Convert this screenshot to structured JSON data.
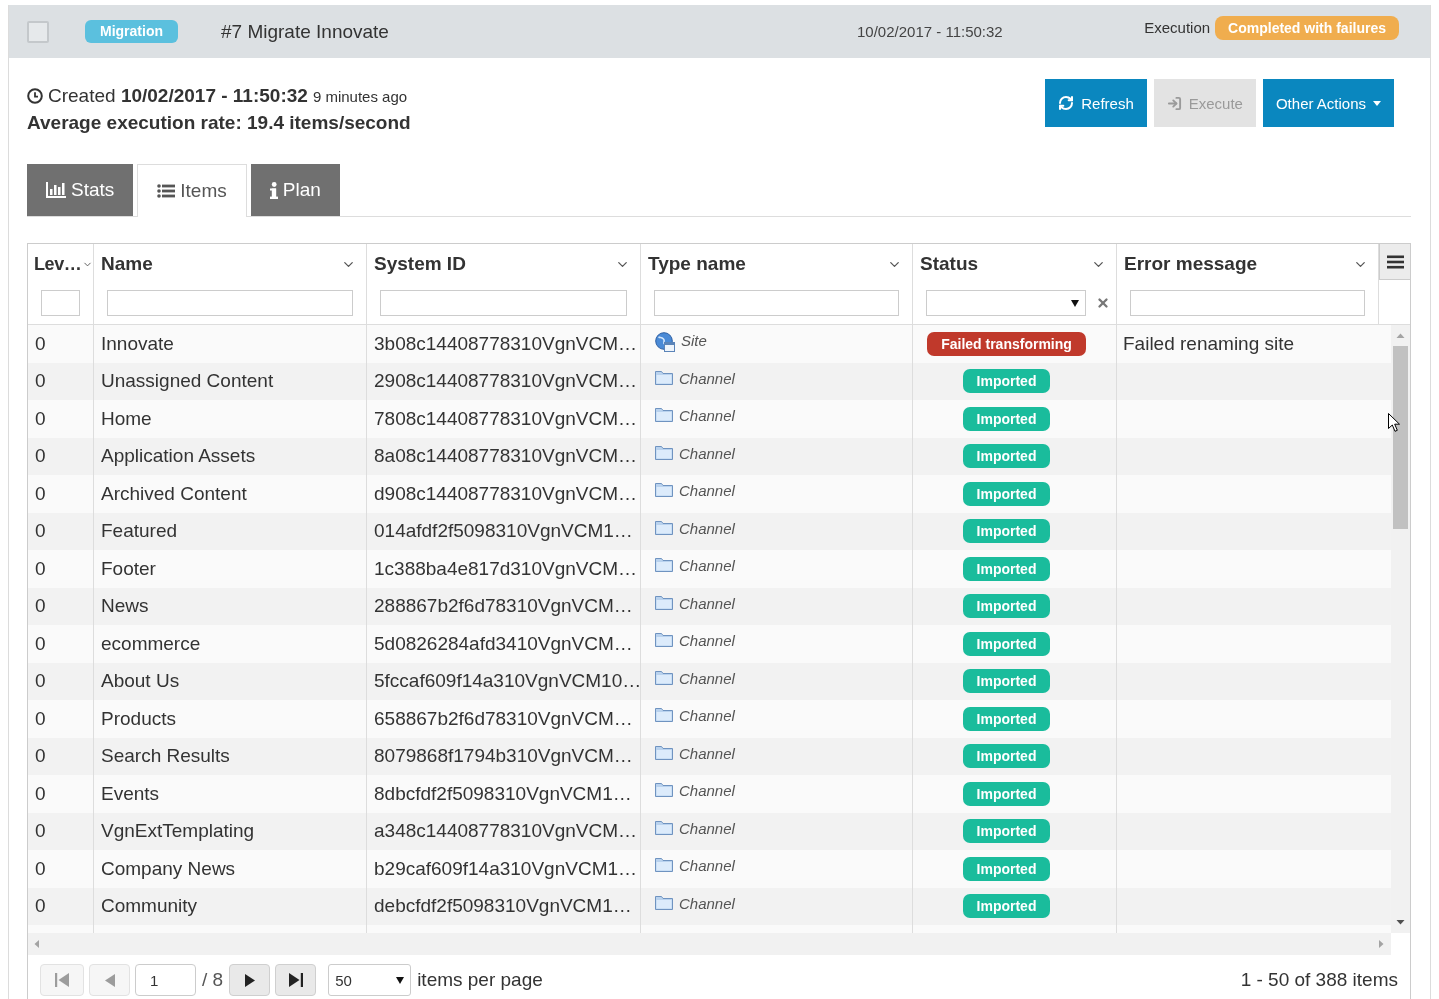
{
  "job": {
    "checked": false,
    "category": "Migration",
    "title": "#7 Migrate Innovate",
    "date": "10/02/2017 - 11:50:32",
    "execution_label": "Execution",
    "execution_status": "Completed with failures"
  },
  "summary": {
    "created": "Created **10/02/2017 - 11:50:32**",
    "created_ago": "9 minutes ago",
    "rate": "Average execution rate: 19.4 items/second"
  },
  "actions": [
    {
      "label": "Refresh",
      "kind": "button",
      "disabled": false
    },
    {
      "label": "Execute",
      "kind": "button",
      "disabled": true
    },
    {
      "label": "Other Actions",
      "kind": "dropdown",
      "disabled": false
    }
  ],
  "tabs": [
    {
      "label": "Stats",
      "selected": false
    },
    {
      "label": "Items",
      "selected": true
    },
    {
      "label": "Plan",
      "selected": false
    }
  ],
  "table": {
    "columns": [
      {
        "title": "Lev…",
        "kind": "text"
      },
      {
        "title": "Name",
        "kind": "text"
      },
      {
        "title": "System ID",
        "kind": "text"
      },
      {
        "title": "Type name",
        "kind": "text"
      },
      {
        "title": "Status",
        "kind": "select"
      },
      {
        "title": "Error message",
        "kind": "text"
      }
    ],
    "rows": [
      {
        "lev": "0",
        "name": "Innovate",
        "system_id": "3b08c14408778310VgnVCM…",
        "type": {
          "kind": "site",
          "label": "Site"
        },
        "status": {
          "label": "Failed transforming",
          "color": "#c0392b"
        },
        "error": "Failed renaming site"
      },
      {
        "lev": "0",
        "name": "Unassigned Content",
        "system_id": "2908c14408778310VgnVCM…",
        "type": {
          "kind": "channel",
          "label": "Channel"
        },
        "status": {
          "label": "Imported",
          "color": "#1abc9c"
        }
      },
      {
        "lev": "0",
        "name": "Home",
        "system_id": "7808c14408778310VgnVCM…",
        "type": {
          "kind": "channel",
          "label": "Channel"
        },
        "status": {
          "label": "Imported",
          "color": "#1abc9c"
        }
      },
      {
        "lev": "0",
        "name": "Application Assets",
        "system_id": "8a08c14408778310VgnVCM…",
        "type": {
          "kind": "channel",
          "label": "Channel"
        },
        "status": {
          "label": "Imported",
          "color": "#1abc9c"
        }
      },
      {
        "lev": "0",
        "name": "Archived Content",
        "system_id": "d908c14408778310VgnVCM…",
        "type": {
          "kind": "channel",
          "label": "Channel"
        },
        "status": {
          "label": "Imported",
          "color": "#1abc9c"
        }
      },
      {
        "lev": "0",
        "name": "Featured",
        "system_id": "014afdf2f5098310VgnVCM1…",
        "type": {
          "kind": "channel",
          "label": "Channel"
        },
        "status": {
          "label": "Imported",
          "color": "#1abc9c"
        }
      },
      {
        "lev": "0",
        "name": "Footer",
        "system_id": "1c388ba4e817d310VgnVCM…",
        "type": {
          "kind": "channel",
          "label": "Channel"
        },
        "status": {
          "label": "Imported",
          "color": "#1abc9c"
        }
      },
      {
        "lev": "0",
        "name": "News",
        "system_id": "288867b2f6d78310VgnVCM…",
        "type": {
          "kind": "channel",
          "label": "Channel"
        },
        "status": {
          "label": "Imported",
          "color": "#1abc9c"
        }
      },
      {
        "lev": "0",
        "name": "ecommerce",
        "system_id": "5d0826284afd3410VgnVCM…",
        "type": {
          "kind": "channel",
          "label": "Channel"
        },
        "status": {
          "label": "Imported",
          "color": "#1abc9c"
        }
      },
      {
        "lev": "0",
        "name": "About Us",
        "system_id": "5fccaf609f14a310VgnVCM10…",
        "type": {
          "kind": "channel",
          "label": "Channel"
        },
        "status": {
          "label": "Imported",
          "color": "#1abc9c"
        }
      },
      {
        "lev": "0",
        "name": "Products",
        "system_id": "658867b2f6d78310VgnVCM…",
        "type": {
          "kind": "channel",
          "label": "Channel"
        },
        "status": {
          "label": "Imported",
          "color": "#1abc9c"
        }
      },
      {
        "lev": "0",
        "name": "Search Results",
        "system_id": "8079868f1794b310VgnVCM…",
        "type": {
          "kind": "channel",
          "label": "Channel"
        },
        "status": {
          "label": "Imported",
          "color": "#1abc9c"
        }
      },
      {
        "lev": "0",
        "name": "Events",
        "system_id": "8dbcfdf2f5098310VgnVCM1…",
        "type": {
          "kind": "channel",
          "label": "Channel"
        },
        "status": {
          "label": "Imported",
          "color": "#1abc9c"
        }
      },
      {
        "lev": "0",
        "name": "VgnExtTemplating",
        "system_id": "a348c14408778310VgnVCM…",
        "type": {
          "kind": "channel",
          "label": "Channel"
        },
        "status": {
          "label": "Imported",
          "color": "#1abc9c"
        }
      },
      {
        "lev": "0",
        "name": "Company News",
        "system_id": "b29caf609f14a310VgnVCM1…",
        "type": {
          "kind": "channel",
          "label": "Channel"
        },
        "status": {
          "label": "Imported",
          "color": "#1abc9c"
        }
      },
      {
        "lev": "0",
        "name": "Community",
        "system_id": "debcfdf2f5098310VgnVCM1…",
        "type": {
          "kind": "channel",
          "label": "Channel"
        },
        "status": {
          "label": "Imported",
          "color": "#1abc9c"
        }
      }
    ]
  },
  "pager": {
    "buttons_before": [
      {
        "kind": "first",
        "disabled": true
      },
      {
        "kind": "prev",
        "disabled": true
      }
    ],
    "page": "1",
    "total": "/ 8",
    "buttons_after": [
      {
        "kind": "next",
        "disabled": false
      },
      {
        "kind": "last",
        "disabled": false
      }
    ],
    "page_size": "50",
    "page_size_label": "items per page",
    "summary": "1 - 50 of 388 items"
  }
}
